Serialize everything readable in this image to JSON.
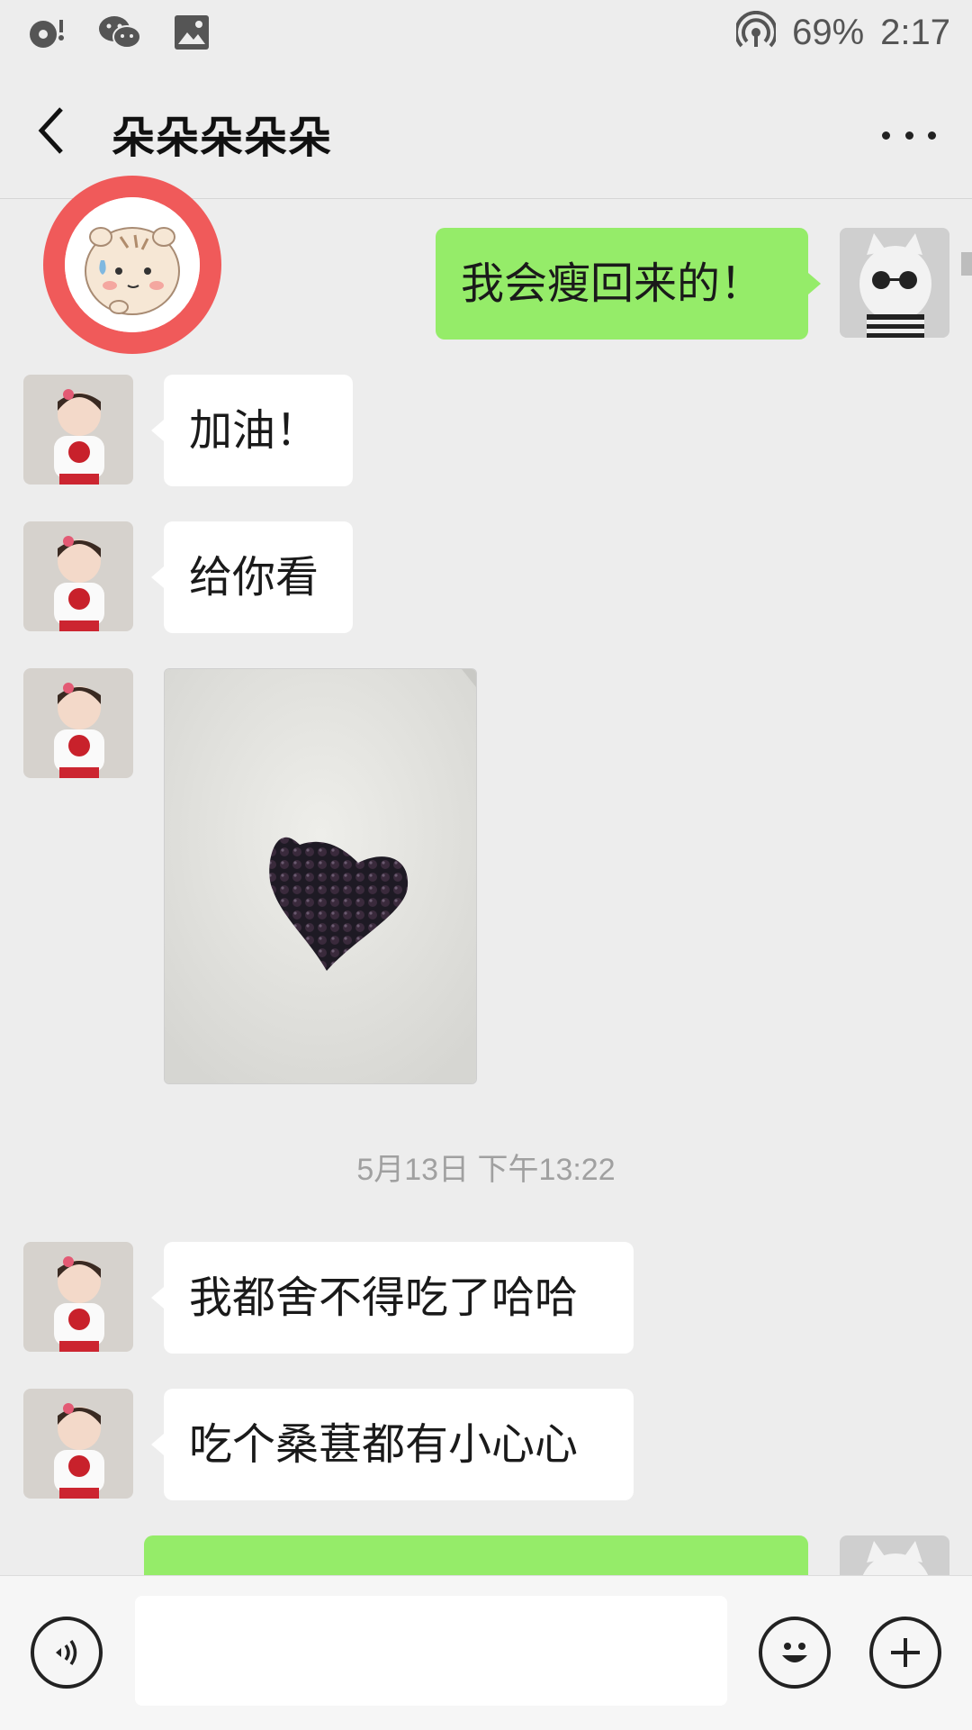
{
  "status_bar": {
    "left_icons": [
      "music-notification-icon",
      "wechat-icon",
      "image-icon"
    ],
    "hotspot_icon": "hotspot-icon",
    "battery": "69%",
    "time": "2:17"
  },
  "header": {
    "title": "朵朵朵朵朵",
    "back_icon": "chevron-left-icon",
    "more_icon": "more-dots-icon"
  },
  "messages": [
    {
      "from": "me",
      "type": "text",
      "text": "我会瘦回来的！"
    },
    {
      "from": "contact",
      "type": "text",
      "text": "加油！"
    },
    {
      "from": "contact",
      "type": "text",
      "text": "给你看"
    },
    {
      "from": "contact",
      "type": "image",
      "description_icon": "heart-mulberry-photo"
    },
    {
      "from": "contact",
      "type": "text",
      "text": "我都舍不得吃了哈哈"
    },
    {
      "from": "contact",
      "type": "text",
      "text": "吃个桑葚都有小心心"
    },
    {
      "from": "me",
      "type": "text",
      "text": ""
    }
  ],
  "timestamp": "5月13日 下午13:22",
  "input_bar": {
    "voice_icon": "voice-icon",
    "input_value": "",
    "emoji_icon": "emoji-icon",
    "plus_icon": "plus-icon"
  },
  "colors": {
    "background": "#ededed",
    "outgoing_bubble": "#95ec69",
    "incoming_bubble": "#ffffff",
    "sticker_ring": "#f05a5a"
  }
}
